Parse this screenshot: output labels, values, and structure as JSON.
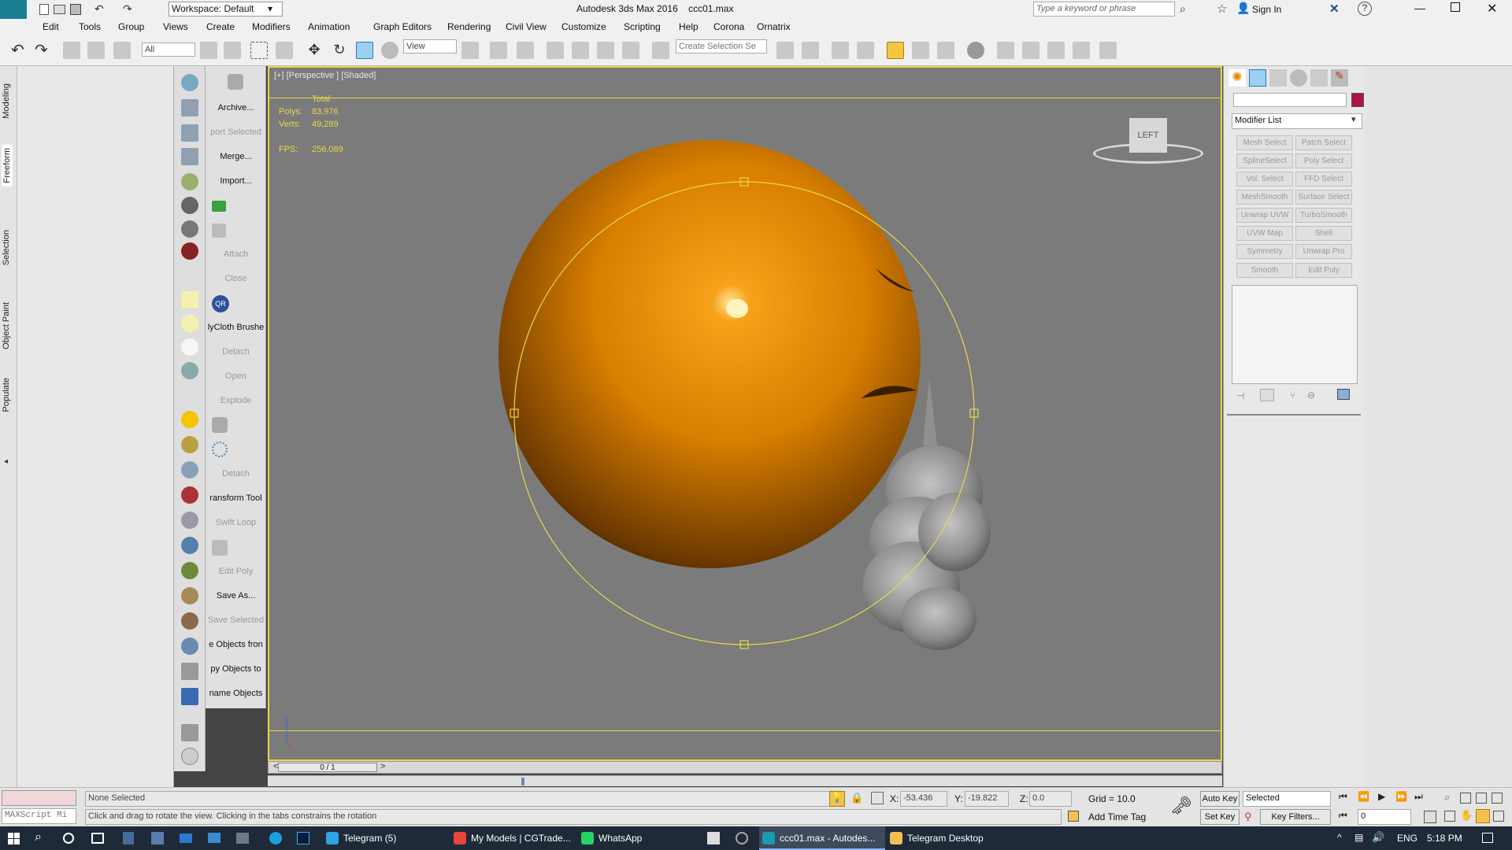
{
  "window": {
    "title": "Autodesk 3ds Max 2016",
    "file": "ccc01.max",
    "workspace": "Workspace: Default",
    "search_placeholder": "Type a keyword or phrase",
    "sign_in": "Sign In"
  },
  "menu": [
    "Edit",
    "Tools",
    "Group",
    "Views",
    "Create",
    "Modifiers",
    "Animation",
    "Graph Editors",
    "Rendering",
    "Civil View",
    "Customize",
    "Scripting",
    "Help",
    "Corona",
    "Ornatrix"
  ],
  "toolbar": {
    "filter_value": "All",
    "refcoord_value": "View",
    "named_selection_placeholder": "Create Selection Se"
  },
  "left_tabs": [
    "Modeling",
    "Freeform",
    "Selection",
    "Object Paint",
    "Populate"
  ],
  "text_column": [
    {
      "label": "Archive...",
      "enabled": true
    },
    {
      "label": "port Selected",
      "enabled": false
    },
    {
      "label": "Merge...",
      "enabled": true
    },
    {
      "label": "Import...",
      "enabled": true
    },
    {
      "label": "Attach",
      "enabled": false
    },
    {
      "label": "Close",
      "enabled": false
    },
    {
      "label": "lyCloth Brushe",
      "enabled": true
    },
    {
      "label": "Detach",
      "enabled": false
    },
    {
      "label": "Open",
      "enabled": false
    },
    {
      "label": "Explode",
      "enabled": false
    },
    {
      "label": "Detach",
      "enabled": false
    },
    {
      "label": "ransform Tool",
      "enabled": true
    },
    {
      "label": "Swift Loop",
      "enabled": false
    },
    {
      "label": "Edit Poly",
      "enabled": false
    },
    {
      "label": "Save As...",
      "enabled": true
    },
    {
      "label": "Save Selected",
      "enabled": false
    },
    {
      "label": "e Objects fron",
      "enabled": true
    },
    {
      "label": "py Objects to",
      "enabled": true
    },
    {
      "label": "name Objects",
      "enabled": true
    }
  ],
  "viewport": {
    "label": "[+] [Perspective ] [Shaded]",
    "stats_total_label": "Total",
    "polys_label": "Polys:",
    "polys_value": "83,976",
    "verts_label": "Verts:",
    "verts_value": "49,289",
    "fps_label": "FPS:",
    "fps_value": "256.089",
    "viewcube_label": "LEFT",
    "time_slider": "0 / 1",
    "colors": {
      "sphere": "#e08a00",
      "border": "#e8d84a",
      "bg": "#7b7b7b"
    }
  },
  "command_panel": {
    "modifier_list": "Modifier List",
    "buttons": [
      [
        "Mesh Select",
        "Patch Select"
      ],
      [
        "SplineSelect",
        "Poly Select"
      ],
      [
        "Vol. Select",
        "FFD Select"
      ],
      [
        "MeshSmooth",
        "Surface Select"
      ],
      [
        "Unwrap UVW",
        "TurboSmooth"
      ],
      [
        "UVW Map",
        "Shell"
      ],
      [
        "Symmetry",
        "Unwrap Pro"
      ],
      [
        "Smooth",
        "Edit Poly"
      ]
    ],
    "object_color": "#b0124a"
  },
  "status": {
    "selection": "None Selected",
    "prompt": "Click and drag to rotate the view.  Clicking in the tabs constrains the rotation",
    "maxscript": "MAXScript Mi",
    "x_label": "X:",
    "x_value": "-53.436",
    "y_label": "Y:",
    "y_value": "-19.822",
    "z_label": "Z:",
    "z_value": "0.0",
    "grid": "Grid = 10.0",
    "add_time_tag": "Add Time Tag",
    "auto_key": "Auto Key",
    "set_key": "Set Key",
    "selected_dropdown": "Selected",
    "key_filters": "Key Filters...",
    "frame_value": "0"
  },
  "taskbar": {
    "items": [
      {
        "label": "Telegram (5)",
        "color": "#2ca5e0",
        "active": false
      },
      {
        "label": "My Models | CGTrade...",
        "color": "#e8453c",
        "active": false
      },
      {
        "label": "WhatsApp",
        "color": "#25d366",
        "active": false
      },
      {
        "label": "ccc01.max - Autodes...",
        "color": "#1a9bb0",
        "active": true
      },
      {
        "label": "Telegram Desktop",
        "color": "#f2c14e",
        "active": false
      }
    ],
    "lang": "ENG",
    "time": "5:18 PM"
  }
}
